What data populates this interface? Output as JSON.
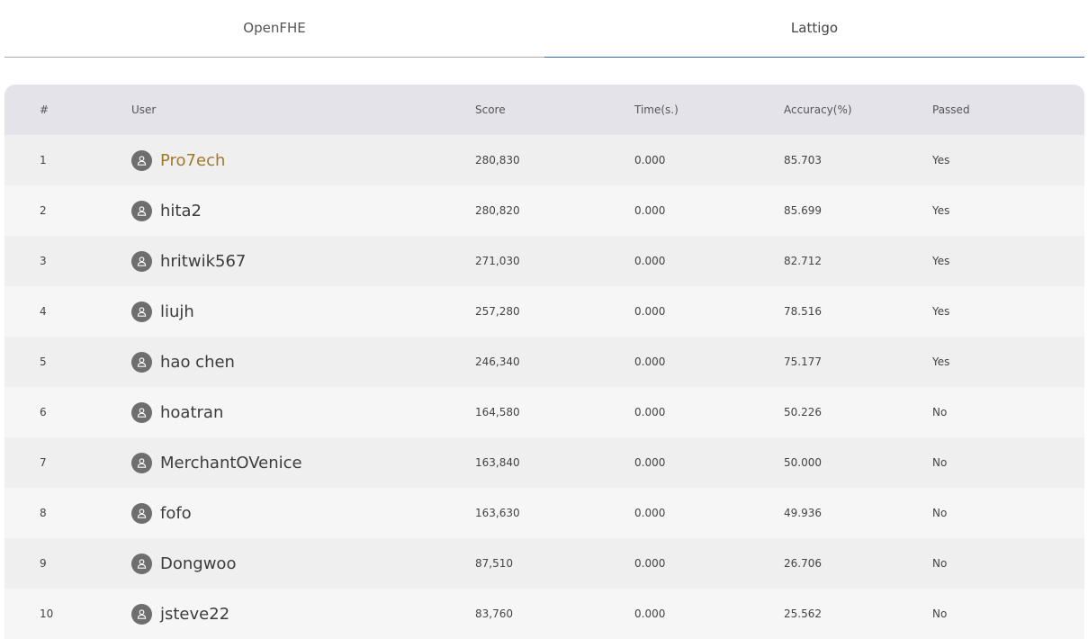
{
  "tabs": [
    {
      "label": "OpenFHE",
      "active": false
    },
    {
      "label": "Lattigo",
      "active": true
    }
  ],
  "colors": {
    "active_tab_underline": "#3a62a8",
    "header_bg": "#e4e3ea",
    "top_user": "#a3782a",
    "avatar": "#6e6e6e"
  },
  "table": {
    "headers": {
      "rank": "#",
      "user": "User",
      "score": "Score",
      "time": "Time(s.)",
      "accuracy": "Accuracy(%)",
      "passed": "Passed"
    },
    "rows": [
      {
        "rank": "1",
        "user": "Pro7ech",
        "score": "280,830",
        "time": "0.000",
        "accuracy": "85.703",
        "passed": "Yes"
      },
      {
        "rank": "2",
        "user": "hita2",
        "score": "280,820",
        "time": "0.000",
        "accuracy": "85.699",
        "passed": "Yes"
      },
      {
        "rank": "3",
        "user": "hritwik567",
        "score": "271,030",
        "time": "0.000",
        "accuracy": "82.712",
        "passed": "Yes"
      },
      {
        "rank": "4",
        "user": "liujh",
        "score": "257,280",
        "time": "0.000",
        "accuracy": "78.516",
        "passed": "Yes"
      },
      {
        "rank": "5",
        "user": "hao chen",
        "score": "246,340",
        "time": "0.000",
        "accuracy": "75.177",
        "passed": "Yes"
      },
      {
        "rank": "6",
        "user": "hoatran",
        "score": "164,580",
        "time": "0.000",
        "accuracy": "50.226",
        "passed": "No"
      },
      {
        "rank": "7",
        "user": "MerchantOVenice",
        "score": "163,840",
        "time": "0.000",
        "accuracy": "50.000",
        "passed": "No"
      },
      {
        "rank": "8",
        "user": "fofo",
        "score": "163,630",
        "time": "0.000",
        "accuracy": "49.936",
        "passed": "No"
      },
      {
        "rank": "9",
        "user": "Dongwoo",
        "score": "87,510",
        "time": "0.000",
        "accuracy": "26.706",
        "passed": "No"
      },
      {
        "rank": "10",
        "user": "jsteve22",
        "score": "83,760",
        "time": "0.000",
        "accuracy": "25.562",
        "passed": "No"
      }
    ]
  }
}
